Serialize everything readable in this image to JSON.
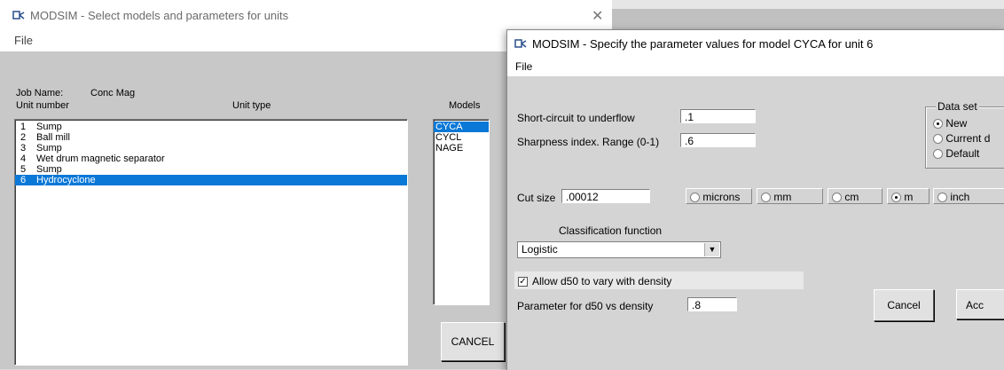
{
  "back_window": {
    "title": "MODSIM - Select models and parameters for units",
    "menu": {
      "file": "File"
    },
    "job_name_label": "Job Name:",
    "job_name_value": "Conc Mag",
    "unit_number_header": "Unit number",
    "unit_type_header": "Unit type",
    "models_header": "Models",
    "units": [
      {
        "num": "1",
        "name": "Sump"
      },
      {
        "num": "2",
        "name": "Ball mill"
      },
      {
        "num": "3",
        "name": "Sump"
      },
      {
        "num": "4",
        "name": "Wet drum magnetic separator"
      },
      {
        "num": "5",
        "name": "Sump"
      },
      {
        "num": "6",
        "name": "Hydrocyclone"
      }
    ],
    "models": [
      "CYCA",
      "CYCL",
      "NAGE"
    ],
    "cancel_label": "CANCEL"
  },
  "dialog": {
    "title": "MODSIM - Specify the parameter values for model CYCA for unit 6",
    "menu": {
      "file": "File"
    },
    "short_circuit_label": "Short-circuit to underflow",
    "short_circuit_value": ".1",
    "sharpness_label": "Sharpness index.  Range (0-1)",
    "sharpness_value": ".6",
    "data_set": {
      "label": "Data set",
      "options": [
        "New",
        "Current d",
        "Default"
      ],
      "selected": "New"
    },
    "cut_size_label": "Cut size",
    "cut_size_value": ".00012",
    "units": [
      "microns",
      "mm",
      "cm",
      "m",
      "inch"
    ],
    "selected_unit": "m",
    "classification_label": "Classification function",
    "classification_value": "Logistic",
    "allow_d50_label": "Allow d50 to vary with density",
    "allow_d50_checked": true,
    "d50_param_label": "Parameter for d50 vs density",
    "d50_param_value": ".8",
    "cancel_label": "Cancel",
    "accept_label": "Acc"
  }
}
